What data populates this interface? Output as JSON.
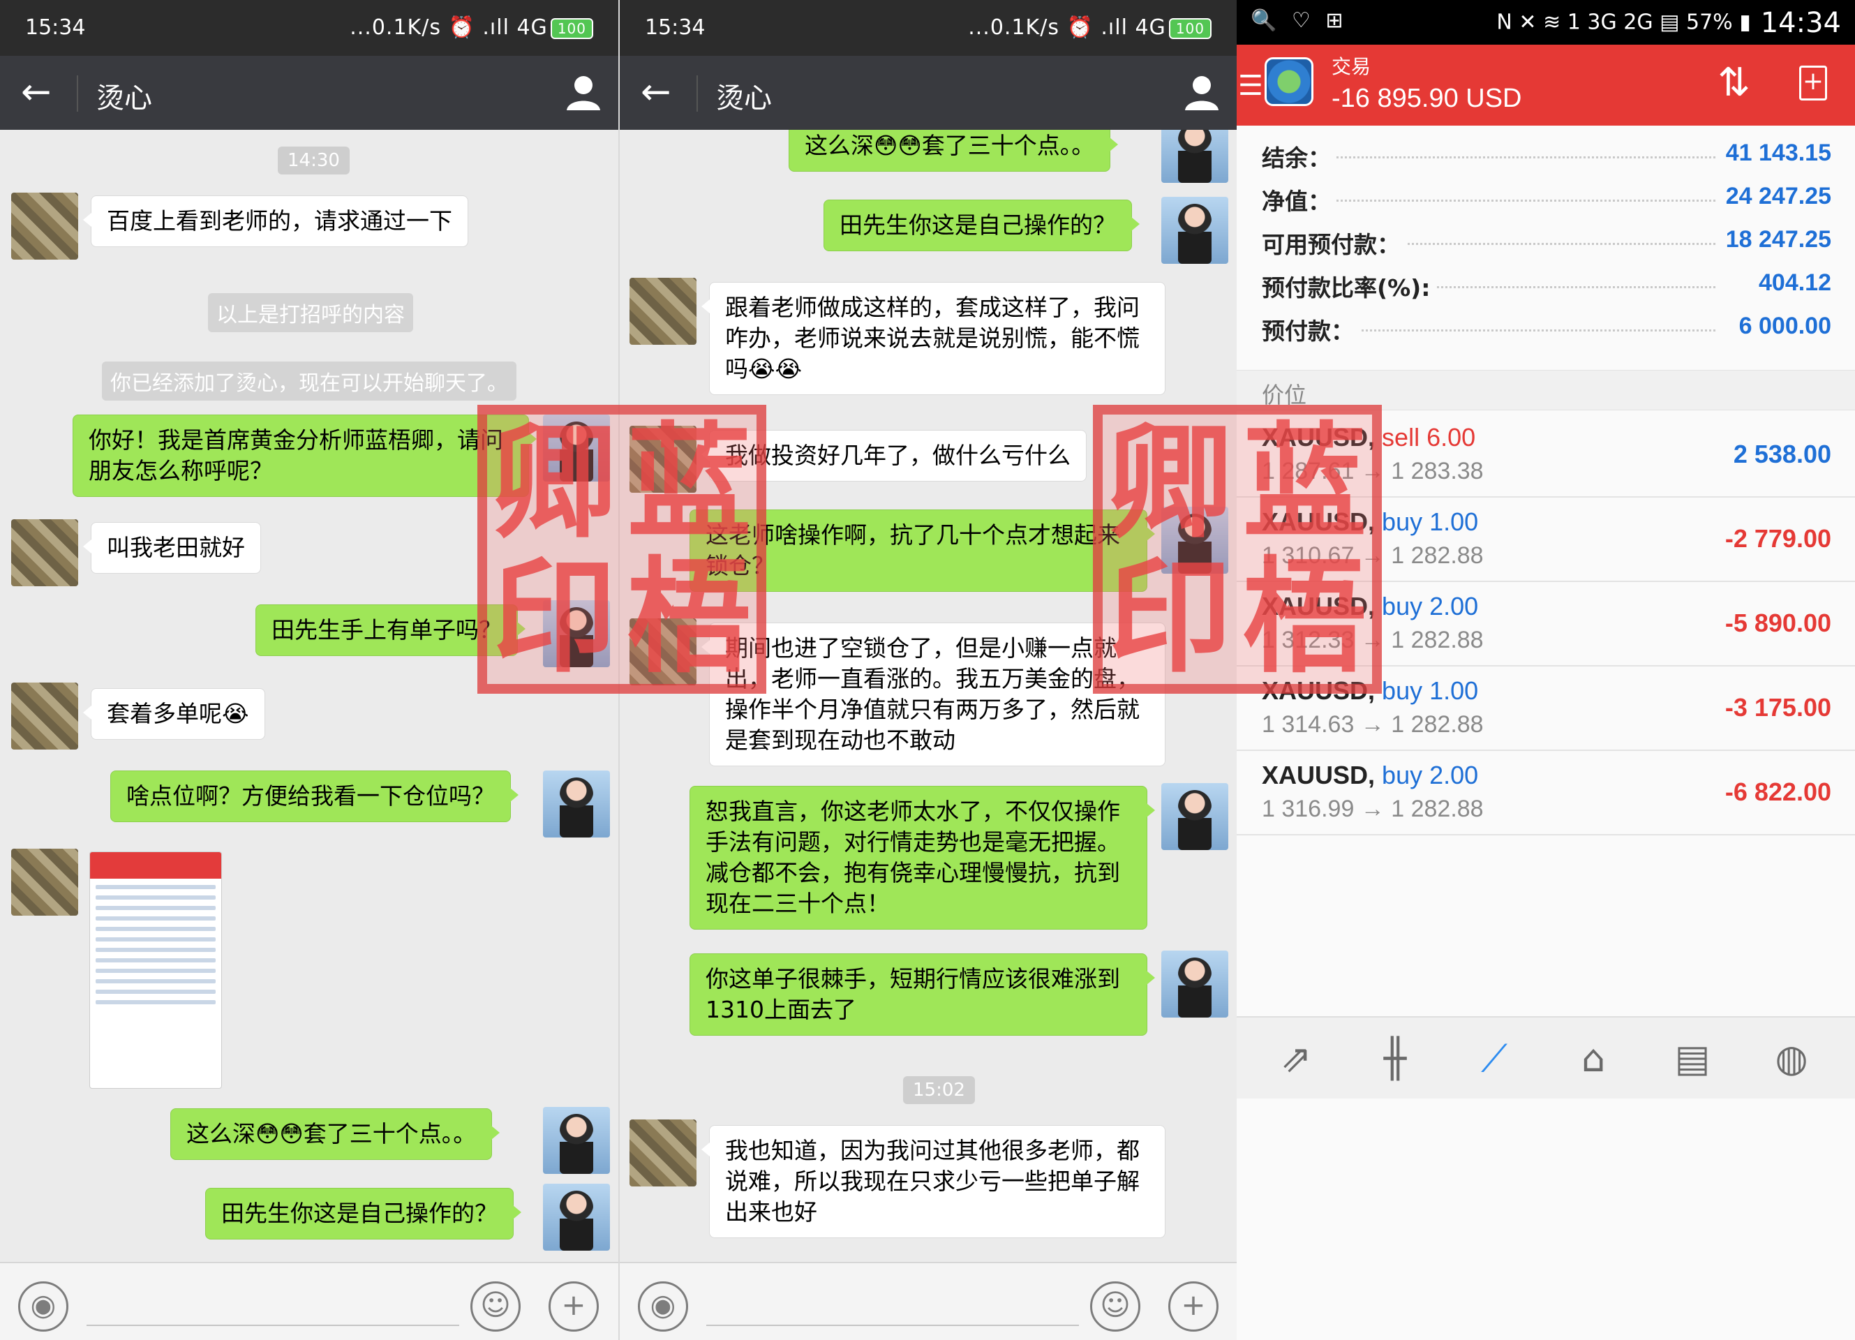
{
  "chat1": {
    "status": {
      "time": "15:34",
      "icons": "...0.1K/s ⏰ .ıll 4G",
      "battery": "100"
    },
    "title": "烫心",
    "timestamp": "14:30",
    "messages": [
      {
        "from": "friend",
        "text": "百度上看到老师的，请求通过一下"
      },
      {
        "from": "system",
        "text": "以上是打招呼的内容"
      },
      {
        "from": "system",
        "text": "你已经添加了烫心，现在可以开始聊天了。"
      },
      {
        "from": "me",
        "text": "你好！我是首席黄金分析师蓝梧卿，请问朋友怎么称呼呢？"
      },
      {
        "from": "friend",
        "text": "叫我老田就好"
      },
      {
        "from": "me",
        "text": "田先生手上有单子吗？"
      },
      {
        "from": "friend",
        "text": "套着多单呢😭"
      },
      {
        "from": "me",
        "text": "啥点位啊？方便给我看一下仓位吗？"
      },
      {
        "from": "friend",
        "text": "[screenshot]"
      },
      {
        "from": "me",
        "text": "这么深😳😳套了三十个点。。"
      },
      {
        "from": "me",
        "text": "田先生你这是自己操作的？"
      }
    ]
  },
  "chat2": {
    "status": {
      "time": "15:34",
      "icons": "...0.1K/s ⏰ .ıll 4G",
      "battery": "100"
    },
    "title": "烫心",
    "timestamp": "15:02",
    "messages": [
      {
        "from": "me",
        "text": "这么深😳😳套了三十个点。。"
      },
      {
        "from": "me",
        "text": "田先生你这是自己操作的？"
      },
      {
        "from": "friend",
        "text": "跟着老师做成这样的，套成这样了，我问咋办，老师说来说去就是说别慌，能不慌吗😭😭"
      },
      {
        "from": "friend",
        "text": "我做投资好几年了，做什么亏什么"
      },
      {
        "from": "me",
        "text": "这老师啥操作啊，抗了几十个点才想起来锁仓？"
      },
      {
        "from": "friend",
        "text": "期间也进了空锁仓了，但是小赚一点就出，老师一直看涨的。我五万美金的盘，操作半个月净值就只有两万多了，然后就是套到现在动也不敢动"
      },
      {
        "from": "me",
        "text": "恕我直言，你这老师太水了，不仅仅操作手法有问题，对行情走势也是毫无把握。减仓都不会，抱有侥幸心理慢慢抗，抗到现在二三十个点！"
      },
      {
        "from": "me",
        "text": "你这单子很棘手，短期行情应该很难涨到1310上面去了"
      },
      {
        "from": "friend",
        "text": "我也知道，因为我问过其他很多老师，都说难，所以我现在只求少亏一些把单子解出来也好"
      }
    ]
  },
  "trade": {
    "status": {
      "left_icons": "🔍 ♡ ⊞",
      "right_icons": "N ✕ ≋ 1 3G 2G ▤ 57% ▮",
      "time": "14:34"
    },
    "header": {
      "label": "交易",
      "value": "-16 895.90 USD"
    },
    "summary": [
      {
        "label": "结余：",
        "value": "41 143.15"
      },
      {
        "label": "净值：",
        "value": "24 247.25"
      },
      {
        "label": "可用预付款：",
        "value": "18 247.25"
      },
      {
        "label": "预付款比率(%):",
        "value": "404.12"
      },
      {
        "label": "预付款：",
        "value": "6 000.00"
      }
    ],
    "section_title": "价位",
    "positions": [
      {
        "symbol": "XAUUSD,",
        "side": "sell 6.00",
        "side_type": "sell",
        "prices": "1 287.61 → 1 283.38",
        "profit": "2 538.00",
        "profit_sign": "pos"
      },
      {
        "symbol": "XAUUSD,",
        "side": "buy 1.00",
        "side_type": "buy",
        "prices": "1 310.67 → 1 282.88",
        "profit": "-2 779.00",
        "profit_sign": "neg"
      },
      {
        "symbol": "XAUUSD,",
        "side": "buy 2.00",
        "side_type": "buy",
        "prices": "1 312.33 → 1 282.88",
        "profit": "-5 890.00",
        "profit_sign": "neg"
      },
      {
        "symbol": "XAUUSD,",
        "side": "buy 1.00",
        "side_type": "buy",
        "prices": "1 314.63 → 1 282.88",
        "profit": "-3 175.00",
        "profit_sign": "neg"
      },
      {
        "symbol": "XAUUSD,",
        "side": "buy 2.00",
        "side_type": "buy",
        "prices": "1 316.99 → 1 282.88",
        "profit": "-6 822.00",
        "profit_sign": "neg"
      }
    ],
    "nav_icons": [
      "trade-icon",
      "quotes-icon",
      "chart-icon",
      "inbox-icon",
      "news-icon",
      "chat-icon"
    ]
  },
  "watermark": {
    "chars": [
      "卿",
      "蓝",
      "印",
      "梧"
    ]
  },
  "colors": {
    "wechat_green": "#9fe658",
    "titlebar": "#393a3f",
    "mt_red": "#e53935",
    "mt_blue": "#1e6fd6"
  }
}
